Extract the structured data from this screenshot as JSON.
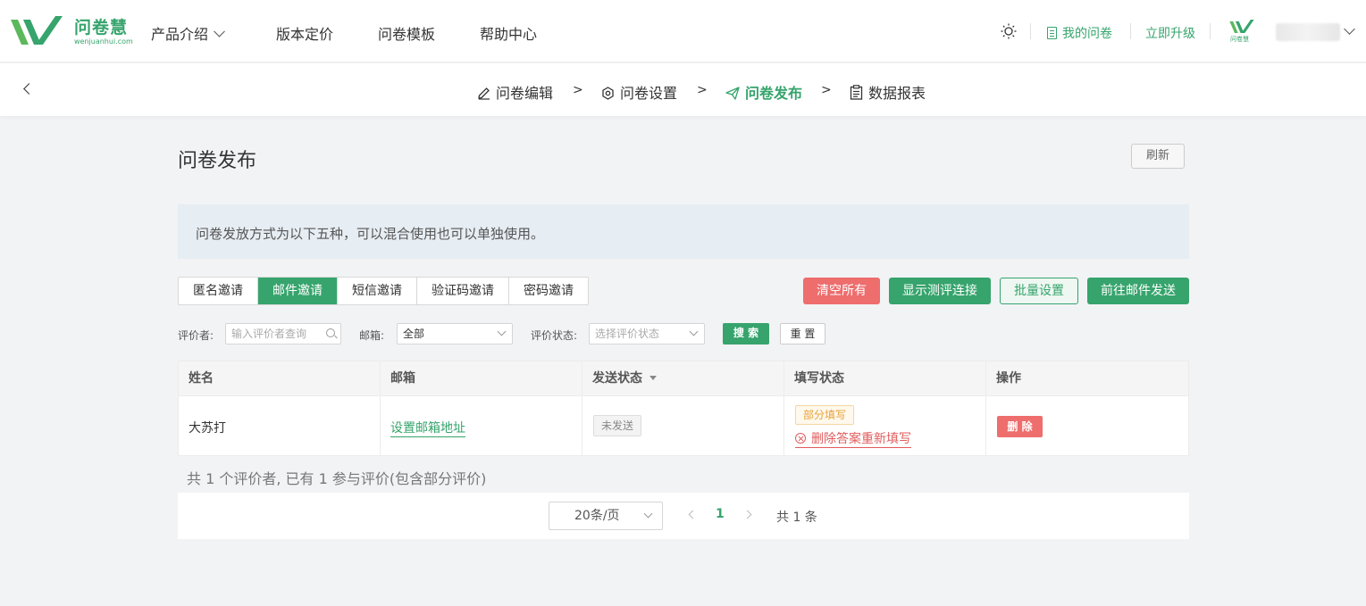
{
  "brand": {
    "name": "问卷慧",
    "domain": "wenjuanhui.com",
    "color": "#36a46c",
    "mini_name": "问卷慧"
  },
  "topnav": {
    "items": [
      {
        "label": "产品介绍",
        "has_dropdown": true
      },
      {
        "label": "版本定价"
      },
      {
        "label": "问卷模板"
      },
      {
        "label": "帮助中心"
      }
    ],
    "my_survey": "我的问卷",
    "upgrade": "立即升级"
  },
  "steps": [
    {
      "label": "问卷编辑",
      "icon": "pencil-icon"
    },
    {
      "label": "问卷设置",
      "icon": "settings-icon"
    },
    {
      "label": "问卷发布",
      "icon": "send-icon",
      "active": true
    },
    {
      "label": "数据报表",
      "icon": "clipboard-icon"
    }
  ],
  "step_separator": ">",
  "page": {
    "title": "问卷发布",
    "refresh": "刷新",
    "notice": "问卷发放方式为以下五种，可以混合使用也可以单独使用。"
  },
  "tabs": [
    {
      "label": "匿名邀请"
    },
    {
      "label": "邮件邀请",
      "active": true
    },
    {
      "label": "短信邀请"
    },
    {
      "label": "验证码邀请"
    },
    {
      "label": "密码邀请"
    }
  ],
  "actions": {
    "clear_all": "清空所有",
    "show_link": "显示测评连接",
    "batch_settings": "批量设置",
    "go_send": "前往邮件发送"
  },
  "filters": {
    "evaluator_label": "评价者:",
    "evaluator_placeholder": "输入评价者查询",
    "email_label": "邮箱:",
    "email_value": "全部",
    "status_label": "评价状态:",
    "status_placeholder": "选择评价状态",
    "search": "搜 索",
    "reset": "重 置"
  },
  "table": {
    "columns": [
      "姓名",
      "邮箱",
      "发送状态",
      "填写状态",
      "操作"
    ],
    "rows": [
      {
        "name": "大苏打",
        "email": "设置邮箱地址",
        "send_status": "未发送",
        "fill_status": "部分填写",
        "reset_action": "删除答案重新填写",
        "delete": "删 除"
      }
    ]
  },
  "summary": "共 1 个评价者, 已有 1 参与评价(包含部分评价)",
  "pagination": {
    "page_size": "20条/页",
    "current_page": "1",
    "total": "共 1 条"
  }
}
